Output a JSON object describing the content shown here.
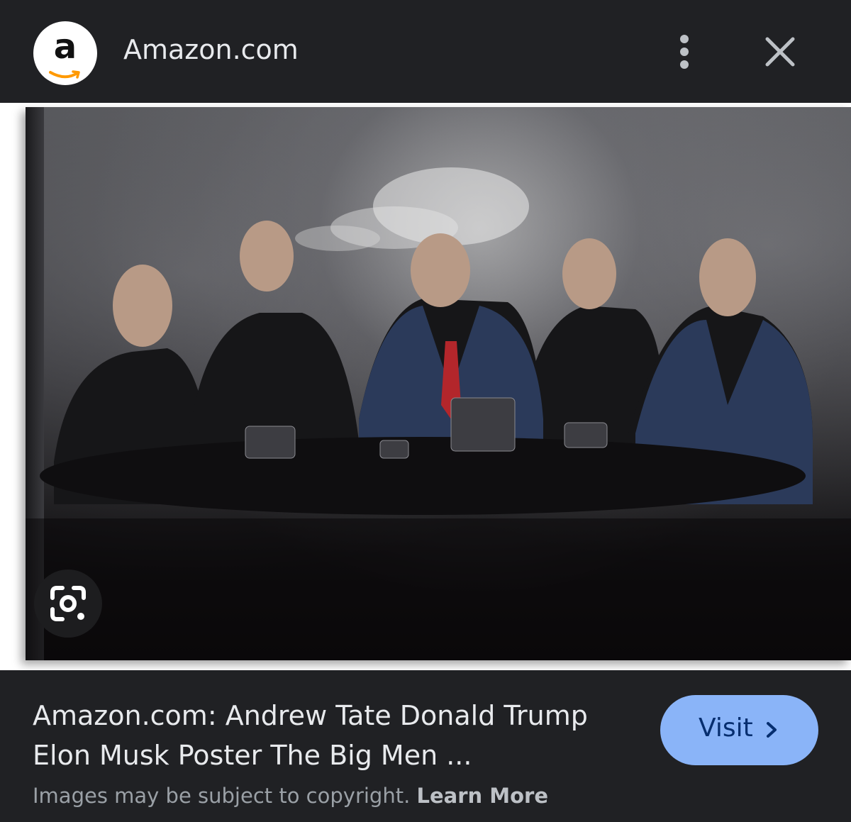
{
  "header": {
    "logo_letter": "a",
    "site_name": "Amazon.com",
    "more_icon": "more-vertical-icon",
    "close_icon": "close-icon"
  },
  "image": {
    "lens_icon": "google-lens-icon"
  },
  "result": {
    "title": "Amazon.com: Andrew Tate Donald Trump Elon Musk Poster The Big Men ...",
    "visit_label": "Visit",
    "visit_icon": "chevron-right-icon",
    "copyright_text": "Images may be subject to copyright.",
    "learn_more": "Learn More"
  },
  "colors": {
    "background": "#202124",
    "title_text": "#e8eaed",
    "muted_text": "#9aa0a6",
    "visit_button": "#8ab4f8",
    "visit_text": "#062e6f",
    "amazon_orange": "#ff9900"
  }
}
